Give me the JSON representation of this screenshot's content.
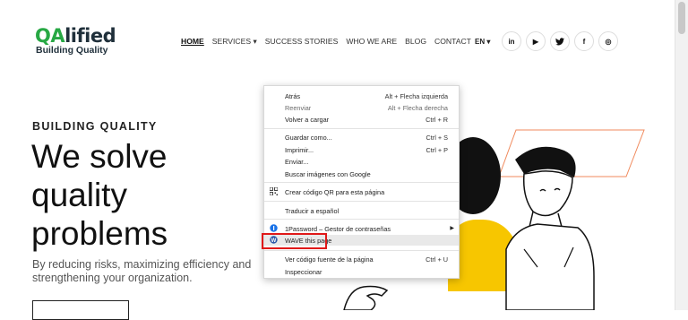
{
  "header": {
    "logo": {
      "prefix": "QA",
      "rest": "lified",
      "tagline": "Building Quality"
    },
    "nav": [
      {
        "label": "HOME",
        "active": true
      },
      {
        "label": "SERVICES ▾",
        "active": false
      },
      {
        "label": "SUCCESS STORIES",
        "active": false
      },
      {
        "label": "WHO WE ARE",
        "active": false
      },
      {
        "label": "BLOG",
        "active": false
      },
      {
        "label": "CONTACT",
        "active": false
      }
    ],
    "language": "EN ▾",
    "socials": [
      {
        "icon": "linkedin-icon",
        "glyph": "in"
      },
      {
        "icon": "youtube-icon",
        "glyph": "▶"
      },
      {
        "icon": "twitter-icon",
        "glyph": "🐦"
      },
      {
        "icon": "facebook-icon",
        "glyph": "f"
      },
      {
        "icon": "instagram-icon",
        "glyph": "◎"
      }
    ]
  },
  "hero": {
    "eyebrow": "BUILDING QUALITY",
    "headline": "We solve quality problems",
    "subtext": "By reducing risks, maximizing efficiency and strengthening your organization."
  },
  "context_menu": {
    "items": [
      {
        "label": "Atrás",
        "shortcut": "Alt + Flecha izquierda",
        "disabled": false
      },
      {
        "label": "Reenviar",
        "shortcut": "Alt + Flecha derecha",
        "disabled": true
      },
      {
        "label": "Volver a cargar",
        "shortcut": "Ctrl + R",
        "disabled": false
      },
      {
        "label": "Guardar como...",
        "shortcut": "Ctrl + S",
        "disabled": false
      },
      {
        "label": "Imprimir...",
        "shortcut": "Ctrl + P",
        "disabled": false
      },
      {
        "label": "Enviar...",
        "shortcut": "",
        "disabled": false
      },
      {
        "label": "Buscar imágenes con Google",
        "shortcut": "",
        "disabled": false
      },
      {
        "label": "Crear código QR para esta página",
        "shortcut": "",
        "disabled": false,
        "icon": "qr-code-icon"
      },
      {
        "label": "Traducir a español",
        "shortcut": "",
        "disabled": false
      },
      {
        "label": "1Password – Gestor de contraseñas",
        "shortcut": "",
        "disabled": false,
        "icon": "1password-icon",
        "submenu": true
      },
      {
        "label": "WAVE this page",
        "shortcut": "",
        "disabled": false,
        "icon": "wave-icon",
        "highlighted": true
      },
      {
        "label": "Ver código fuente de la página",
        "shortcut": "Ctrl + U",
        "disabled": false
      },
      {
        "label": "Inspeccionar",
        "shortcut": "",
        "disabled": false
      }
    ]
  }
}
